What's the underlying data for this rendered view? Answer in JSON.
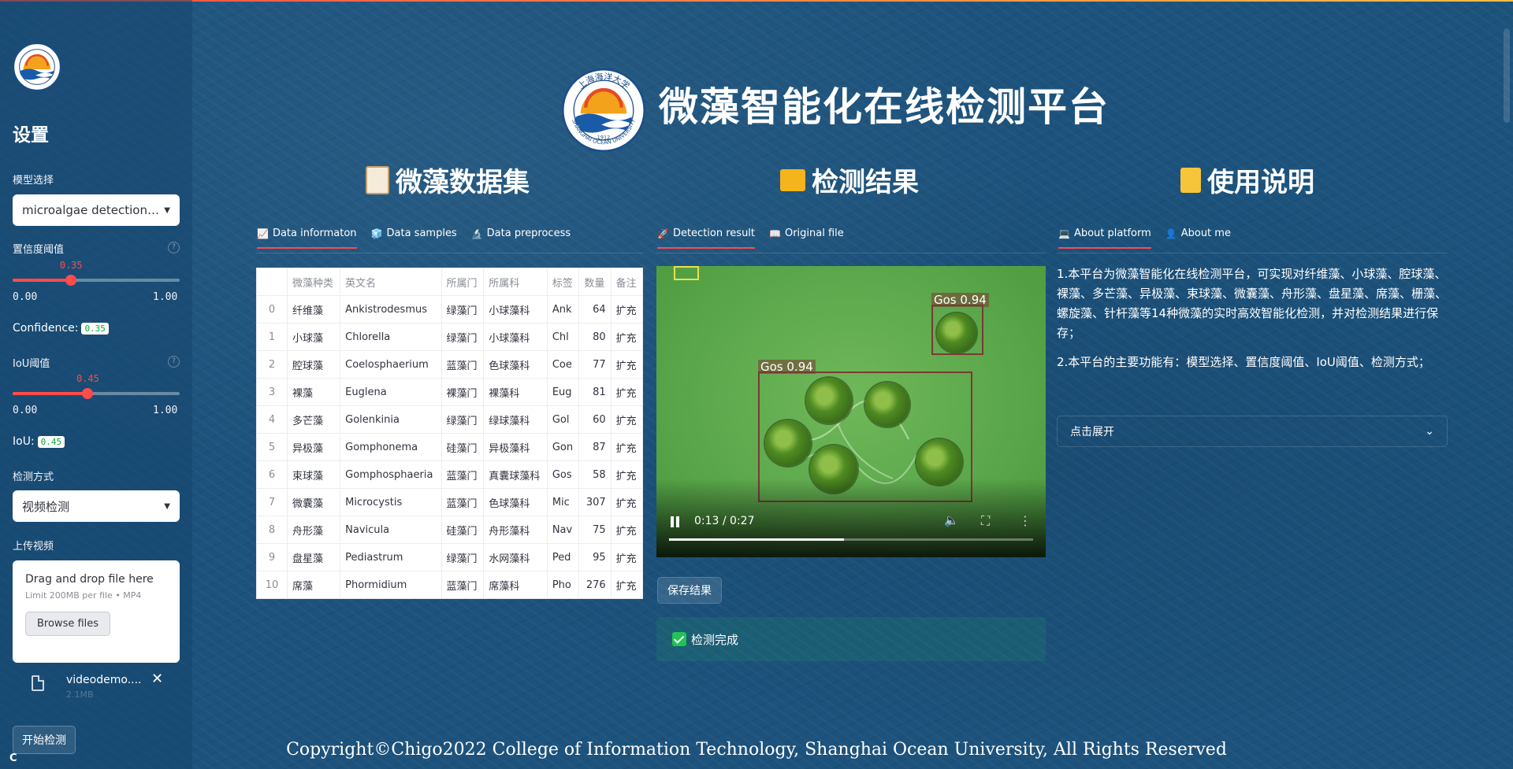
{
  "sidebar": {
    "title": "设置",
    "model_label": "模型选择",
    "model_value": "microalgae detection…",
    "conf_label": "置信度阈值",
    "conf_value": 0.35,
    "conf_value_text": "0.35",
    "conf_min": "0.00",
    "conf_max": "1.00",
    "conf_inline_label": "Confidence:",
    "iou_label": "IoU阈值",
    "iou_value": 0.45,
    "iou_value_text": "0.45",
    "iou_min": "0.00",
    "iou_max": "1.00",
    "iou_inline_label": "IoU:",
    "mode_label": "检测方式",
    "mode_value": "视频检测",
    "upload_label": "上传视频",
    "upload_drag": "Drag and drop file here",
    "upload_limit": "Limit 200MB per file • MP4",
    "browse_label": "Browse files",
    "file_name": "videodemo....",
    "file_size": "2.1MB",
    "close_glyph": "✕",
    "start_label": "开始检测",
    "spinner_glyph": "C"
  },
  "header": {
    "title": "微藻智能化在线检测平台",
    "logo_top": "上海海洋大学",
    "logo_bottom": "SHANGHAI OCEAN UNIVERSITY",
    "logo_year": "1912"
  },
  "dataset": {
    "heading": "微藻数据集",
    "tabs": [
      "Data informaton",
      "Data samples",
      "Data preprocess"
    ],
    "columns": [
      "",
      "微藻种类",
      "英文名",
      "所属门",
      "所属科",
      "标签",
      "数量",
      "备注"
    ],
    "rows": [
      [
        "0",
        "纤维藻",
        "Ankistrodesmus",
        "绿藻门",
        "小球藻科",
        "Ank",
        "64",
        "扩充"
      ],
      [
        "1",
        "小球藻",
        "Chlorella",
        "绿藻门",
        "小球藻科",
        "Chl",
        "80",
        "扩充"
      ],
      [
        "2",
        "腔球藻",
        "Coelosphaerium",
        "蓝藻门",
        "色球藻科",
        "Coe",
        "77",
        "扩充"
      ],
      [
        "3",
        "裸藻",
        "Euglena",
        "裸藻门",
        "裸藻科",
        "Eug",
        "81",
        "扩充"
      ],
      [
        "4",
        "多芒藻",
        "Golenkinia",
        "绿藻门",
        "绿球藻科",
        "Gol",
        "60",
        "扩充"
      ],
      [
        "5",
        "异极藻",
        "Gomphonema",
        "硅藻门",
        "异极藻科",
        "Gon",
        "87",
        "扩充"
      ],
      [
        "6",
        "束球藻",
        "Gomphosphaeria",
        "蓝藻门",
        "真囊球藻科",
        "Gos",
        "58",
        "扩充"
      ],
      [
        "7",
        "微囊藻",
        "Microcystis",
        "蓝藻门",
        "色球藻科",
        "Mic",
        "307",
        "扩充"
      ],
      [
        "8",
        "舟形藻",
        "Navicula",
        "硅藻门",
        "舟形藻科",
        "Nav",
        "75",
        "扩充"
      ],
      [
        "9",
        "盘星藻",
        "Pediastrum",
        "绿藻门",
        "水网藻科",
        "Ped",
        "95",
        "扩充"
      ],
      [
        "10",
        "席藻",
        "Phormidium",
        "蓝藻门",
        "席藻科",
        "Pho",
        "276",
        "扩充"
      ]
    ]
  },
  "detection": {
    "heading": "检测结果",
    "tabs": [
      "Detection result",
      "Original file"
    ],
    "box1_label": "Gos 0.94",
    "box2_label": "Gos 0.94",
    "time_text": "0:13 / 0:27",
    "progress": 0.48,
    "save_label": "保存结果",
    "success_label": "检测完成"
  },
  "usage": {
    "heading": "使用说明",
    "tabs": [
      "About platform",
      "About me"
    ],
    "para1": "1.本平台为微藻智能化在线检测平台，可实现对纤维藻、小球藻、腔球藻、裸藻、多芒藻、异极藻、束球藻、微囊藻、舟形藻、盘星藻、席藻、栅藻、螺旋藻、针杆藻等14种微藻的实时高效智能化检测，并对检测结果进行保存；",
    "para2": "2.本平台的主要功能有：模型选择、置信度阈值、IoU阈值、检测方式；",
    "expander_label": "点击展开"
  },
  "footer": {
    "copyright": "Copyright©Chigo2022 College of Information Technology, Shanghai Ocean University, All Rights Reserved"
  },
  "colors": {
    "background": "#1c527c",
    "accent": "#ff4b4b",
    "success": "#21c354"
  }
}
